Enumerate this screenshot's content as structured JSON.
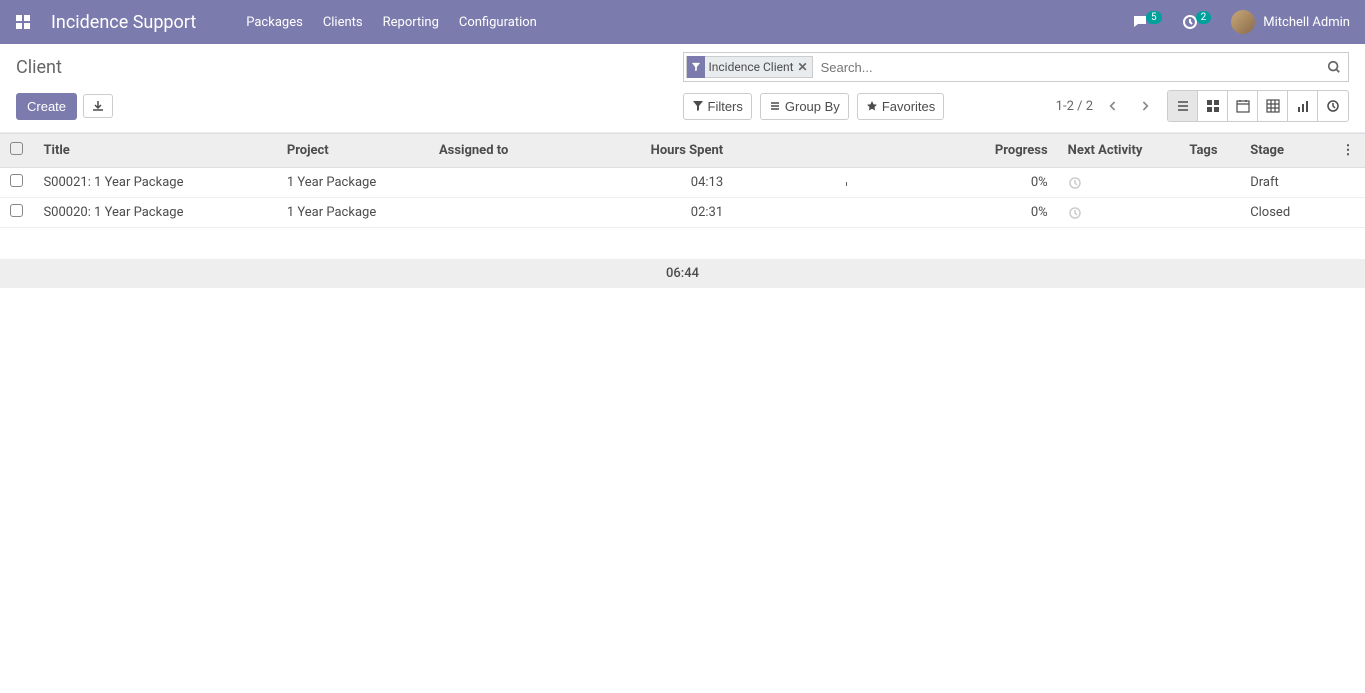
{
  "navbar": {
    "brand": "Incidence Support",
    "items": [
      "Packages",
      "Clients",
      "Reporting",
      "Configuration"
    ],
    "messages_count": "5",
    "activities_count": "2",
    "user_name": "Mitchell Admin"
  },
  "breadcrumb": "Client",
  "search": {
    "chip_label": "Incidence Client",
    "placeholder": "Search..."
  },
  "toolbar": {
    "create_label": "Create",
    "filters_label": "Filters",
    "groupby_label": "Group By",
    "favorites_label": "Favorites"
  },
  "pager": {
    "range": "1-2 / 2"
  },
  "table": {
    "headers": {
      "title": "Title",
      "project": "Project",
      "assigned_to": "Assigned to",
      "hours_spent": "Hours Spent",
      "progress": "Progress",
      "next_activity": "Next Activity",
      "tags": "Tags",
      "stage": "Stage"
    },
    "rows": [
      {
        "title": "S00021: 1 Year Package",
        "project": "1 Year Package",
        "assigned_to": "",
        "hours": "04:13",
        "progress": "0%",
        "stage": "Draft"
      },
      {
        "title": "S00020: 1 Year Package",
        "project": "1 Year Package",
        "assigned_to": "",
        "hours": "02:31",
        "progress": "0%",
        "stage": "Closed"
      }
    ],
    "footer_hours": "06:44"
  }
}
